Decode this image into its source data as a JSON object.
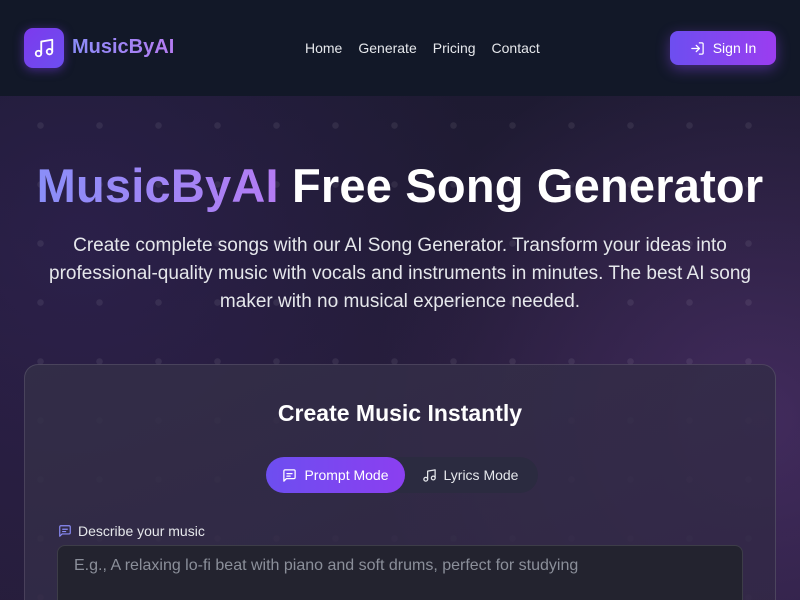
{
  "header": {
    "brand": "MusicByAI",
    "nav": [
      "Home",
      "Generate",
      "Pricing",
      "Contact"
    ],
    "signin_label": "Sign In"
  },
  "hero": {
    "title_highlight": "MusicByAI",
    "title_rest": " Free Song Generator",
    "subtitle": "Create complete songs with our AI Song Generator. Transform your ideas into professional-quality music with vocals and instruments in minutes. The best AI song maker with no musical experience needed."
  },
  "creator": {
    "title": "Create Music Instantly",
    "modes": [
      {
        "label": "Prompt Mode",
        "active": true
      },
      {
        "label": "Lyrics Mode",
        "active": false
      }
    ],
    "field_label": "Describe your music",
    "field_placeholder": "E.g., A relaxing lo-fi beat with piano and soft drums, perfect for studying",
    "field_value": ""
  },
  "colors": {
    "accent": "#6d4ef0",
    "accent_2": "#9b3df0",
    "header_bg": "#121828"
  },
  "icons": {
    "logo": "music-note-icon",
    "signin": "login-icon",
    "prompt_mode": "message-square-icon",
    "lyrics_mode": "music-note-icon",
    "field_label": "message-square-icon"
  }
}
